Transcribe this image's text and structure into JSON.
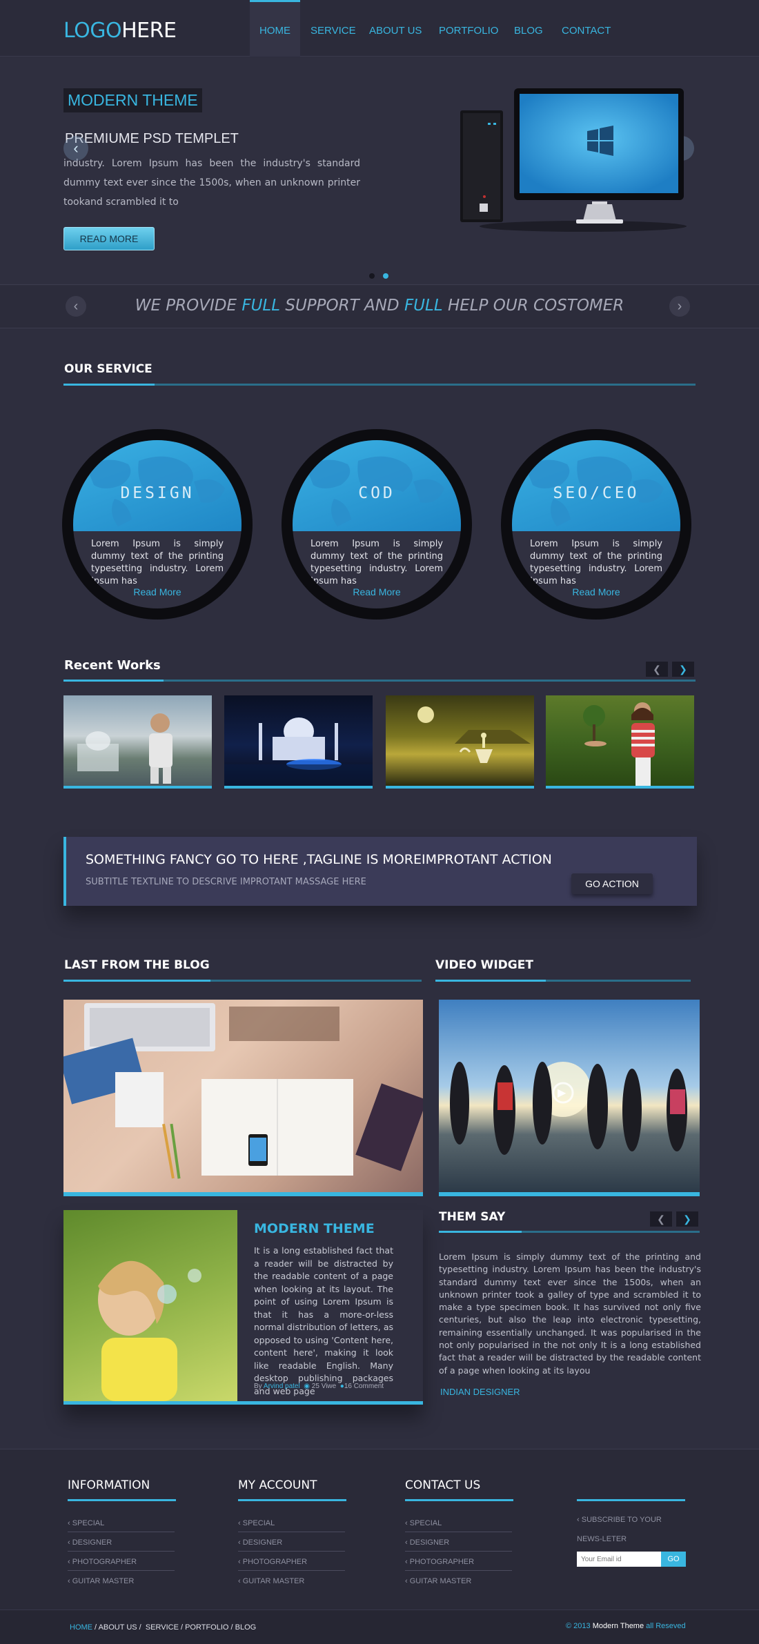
{
  "header": {
    "logo_part1": "LOGO",
    "logo_part2": "HERE",
    "nav": [
      "HOME",
      "SERVICE",
      "ABOUT US",
      "PORTFOLIO",
      "BLOG",
      "CONTACT"
    ],
    "active_nav": "HOME"
  },
  "hero": {
    "tag": "MODERN THEME",
    "subtitle": "PREMIUME PSD TEMPLET",
    "text": "industry. Lorem Ipsum has been the industry's standard dummy text ever since the 1500s, when an unknown printer tookand scrambled it to",
    "button": "READ MORE",
    "slide_count": 2,
    "active_slide": 2
  },
  "tagline": {
    "part1": "WE PROVIDE ",
    "highlight1": "FULL",
    "part2": " SUPPORT AND ",
    "highlight2": "FULL",
    "part3": " HELP OUR COSTOMER"
  },
  "services": {
    "heading": "OUR SERVICE",
    "items": [
      {
        "title": "DESIGN",
        "text": "Lorem Ipsum is simply dummy text of the printing typesetting industry. Lorem Ipsum has",
        "link": "Read More"
      },
      {
        "title": "COD",
        "text": "Lorem Ipsum is simply dummy text of the printing typesetting industry. Lorem Ipsum has",
        "link": "Read More"
      },
      {
        "title": "SEO/CEO",
        "text": "Lorem Ipsum is simply dummy text of the printing typesetting industry. Lorem Ipsum has",
        "link": "Read More"
      }
    ]
  },
  "recent_works": {
    "heading": "Recent Works"
  },
  "cta": {
    "title": "SOMETHING FANCY GO TO HERE ,TAGLINE IS MOREIMPROTANT ACTION",
    "subtitle": "SUBTITLE TEXTLINE  TO DESCRIVE IMPROTANT MASSAGE HERE",
    "button": "GO ACTION"
  },
  "blog": {
    "heading": "LAST FROM THE BLOG",
    "post": {
      "title": "MODERN THEME",
      "text": "It is a long established fact that a reader will be distracted by the readable content of a page when looking at its layout. The point of using Lorem Ipsum is that it has a more-or-less normal distribution of letters, as opposed to using 'Content here, content here', making it look like readable English. Many desktop publishing packages and web page",
      "by": "By ",
      "author": "Arvind patel",
      "views": "25 Viwe",
      "comments": "16 Comment"
    }
  },
  "video": {
    "heading": "VIDEO WIDGET"
  },
  "testimonials": {
    "heading": "THEM SAY",
    "text": "Lorem Ipsum is simply dummy text of the printing and typesetting industry. Lorem Ipsum has been the industry's standard dummy text ever since the 1500s, when an unknown printer took a galley of type and scrambled it to make a type specimen book. It has survived not only five centuries, but also the leap into electronic typesetting, remaining essentially unchanged. It was popularised in the not only popularised in the not only It is a long established fact that a reader will be distracted by the readable content of a page when looking at its layou",
    "author": "INDIAN DESIGNER"
  },
  "footer": {
    "columns": [
      {
        "heading": "INFORMATION",
        "items": [
          "SPECIAL",
          "DESIGNER",
          "PHOTOGRAPHER",
          "GUITAR MASTER"
        ]
      },
      {
        "heading": "MY ACCOUNT",
        "items": [
          "SPECIAL",
          "DESIGNER",
          "PHOTOGRAPHER",
          "GUITAR MASTER"
        ]
      },
      {
        "heading": "CONTACT US",
        "items": [
          "SPECIAL",
          "DESIGNER",
          "PHOTOGRAPHER",
          "GUITAR MASTER"
        ]
      }
    ],
    "subscribe_label": "SUBSCRIBE TO YOUR NEWS-LETER",
    "email_placeholder": "Your Email id",
    "go": "GO",
    "bottom_nav": [
      "HOME",
      "ABOUT US",
      "SERVICE",
      "PORTFOLIO",
      "BLOG"
    ],
    "copyright_prefix": "© 2013 ",
    "copyright_brand": "Modern Theme",
    "copyright_suffix": " all Reseved"
  },
  "colors": {
    "accent": "#39b6e0",
    "background": "#2e2e3e",
    "cta": "#3b3b58"
  }
}
